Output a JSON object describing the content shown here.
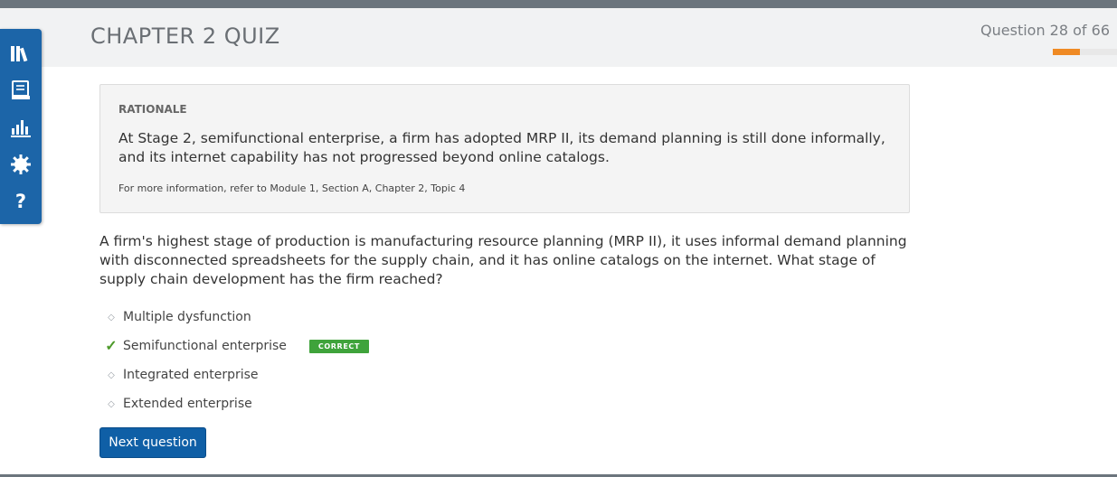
{
  "header": {
    "title": "CHAPTER 2 QUIZ",
    "progress_text": "Question 28 of 66",
    "progress_fraction": 0.4242,
    "progress_color": "#ef8a24"
  },
  "toolbar": {
    "items": [
      {
        "icon": "library-icon"
      },
      {
        "icon": "notebook-icon"
      },
      {
        "icon": "bar-chart-icon"
      },
      {
        "icon": "gear-icon"
      },
      {
        "icon": "help-icon",
        "label": "?"
      }
    ],
    "color": "#1c65a8"
  },
  "rationale": {
    "title": "RATIONALE",
    "text": "At Stage 2, semifunctional enterprise, a firm has adopted MRP II, its demand planning is still done informally, and its internet capability has not progressed beyond online catalogs.",
    "reference": "For more information, refer to Module 1, Section A, Chapter 2, Topic 4"
  },
  "question": {
    "text": "A firm's highest stage of production is manufacturing resource planning (MRP II), it uses informal demand planning with disconnected spreadsheets for the supply chain, and it has online catalogs on the internet. What stage of supply chain development has the firm reached?"
  },
  "answers": [
    {
      "label": "Multiple dysfunction",
      "mark": "◇"
    },
    {
      "label": "Semifunctional enterprise",
      "mark": "✓",
      "badge": "CORRECT"
    },
    {
      "label": "Integrated enterprise",
      "mark": "◇"
    },
    {
      "label": "Extended enterprise",
      "mark": "◇"
    }
  ],
  "next_button": {
    "label": "Next question"
  }
}
